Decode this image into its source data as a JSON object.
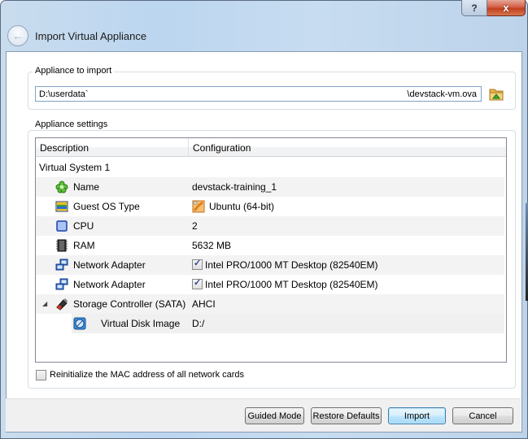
{
  "window": {
    "title": "Import Virtual Appliance",
    "help_label": "?",
    "close_label": "x"
  },
  "appliance_group": {
    "label": "Appliance to import",
    "path_left": "D:\\userdata`",
    "path_right": "\\devstack-vm.ova"
  },
  "settings_group": {
    "label": "Appliance settings",
    "columns": [
      "Description",
      "Configuration"
    ],
    "rows": [
      {
        "description": "Virtual System 1",
        "configuration": "",
        "icon": "none"
      },
      {
        "description": "Name",
        "configuration": "devstack-training_1",
        "icon": "name-icon"
      },
      {
        "description": "Guest OS Type",
        "configuration": "Ubuntu (64-bit)",
        "icon": "os-type-icon"
      },
      {
        "description": "CPU",
        "configuration": "2",
        "icon": "cpu-icon"
      },
      {
        "description": "RAM",
        "configuration": "5632 MB",
        "icon": "ram-icon"
      },
      {
        "description": "Network Adapter",
        "configuration": "Intel PRO/1000 MT Desktop (82540EM)",
        "icon": "network-adapter-icon",
        "checked": true
      },
      {
        "description": "Network Adapter",
        "configuration": "Intel PRO/1000 MT Desktop (82540EM)",
        "icon": "network-adapter-icon",
        "checked": true
      },
      {
        "description": "Storage Controller (SATA)",
        "configuration": "AHCI",
        "icon": "storage-controller-icon",
        "expanded": true
      },
      {
        "description": "Virtual Disk Image",
        "configuration": "D:/",
        "icon": "disk-image-icon"
      }
    ],
    "mac_checkbox_label": "Reinitialize the MAC address of all network cards",
    "mac_checked": false
  },
  "buttons": {
    "guided_mode": "Guided Mode",
    "restore_defaults": "Restore Defaults",
    "import": "Import",
    "cancel": "Cancel"
  }
}
